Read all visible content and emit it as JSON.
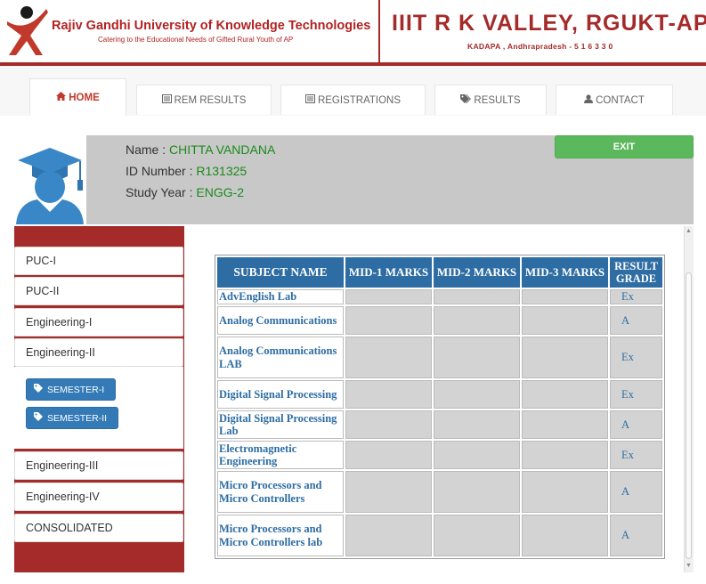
{
  "header": {
    "university_name": "Rajiv Gandhi University of Knowledge Technologies",
    "tagline": "Catering to the Educational Needs of Gifted Rural Youth of AP",
    "campus_name": "IIIT R K VALLEY, RGUKT-AP",
    "campus_address": "KADAPA , Andhrapradesh - 5 1 6 3 3 0"
  },
  "nav": {
    "tabs": [
      {
        "label": "HOME",
        "icon": "home-icon",
        "active": true
      },
      {
        "label": "REM RESULTS",
        "icon": "list-icon",
        "active": false
      },
      {
        "label": "REGISTRATIONS",
        "icon": "list-icon",
        "active": false
      },
      {
        "label": "RESULTS",
        "icon": "tags-icon",
        "active": false
      },
      {
        "label": "CONTACT",
        "icon": "user-icon",
        "active": false
      }
    ]
  },
  "profile": {
    "name_label": "Name :",
    "name_value": "CHITTA VANDANA",
    "id_label": "ID Number :",
    "id_value": "R131325",
    "year_label": "Study Year :",
    "year_value": "ENGG-2",
    "exit_label": "EXIT"
  },
  "sidebar": {
    "items": [
      "PUC-I",
      "PUC-II",
      "Engineering-I",
      "Engineering-II",
      "Engineering-III",
      "Engineering-IV",
      "CONSOLIDATED"
    ],
    "semesters": [
      "SEMESTER-I",
      "SEMESTER-II"
    ]
  },
  "results": {
    "headers": [
      "SUBJECT NAME",
      "MID-1 MARKS",
      "MID-2 MARKS",
      "MID-3 MARKS",
      "RESULT GRADE"
    ],
    "rows": [
      {
        "subject": "AdvEnglish Lab",
        "mid1": "",
        "mid2": "",
        "mid3": "",
        "grade": "Ex"
      },
      {
        "subject": "Analog Communications",
        "mid1": "",
        "mid2": "",
        "mid3": "",
        "grade": "A"
      },
      {
        "subject": "Analog Communications LAB",
        "mid1": "",
        "mid2": "",
        "mid3": "",
        "grade": "Ex"
      },
      {
        "subject": "Digital Signal Processing",
        "mid1": "",
        "mid2": "",
        "mid3": "",
        "grade": "Ex"
      },
      {
        "subject": "Digital Signal Processing Lab",
        "mid1": "",
        "mid2": "",
        "mid3": "",
        "grade": "A"
      },
      {
        "subject": "Electromagnetic Engineering",
        "mid1": "",
        "mid2": "",
        "mid3": "",
        "grade": "Ex"
      },
      {
        "subject": "Micro Processors and Micro Controllers",
        "mid1": "",
        "mid2": "",
        "mid3": "",
        "grade": "A"
      },
      {
        "subject": "Micro Processors and Micro Controllers lab",
        "mid1": "",
        "mid2": "",
        "mid3": "",
        "grade": "A"
      }
    ]
  },
  "colors": {
    "brand_red": "#a52a2a",
    "table_header_blue": "#2e6da4",
    "exit_green": "#5cb85c",
    "value_green": "#1a8a1a",
    "semester_blue": "#337ab7"
  }
}
